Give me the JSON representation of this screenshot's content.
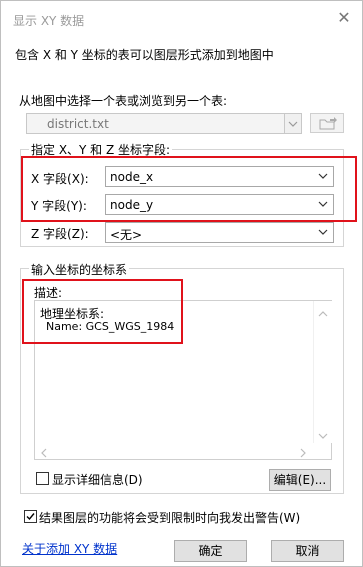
{
  "window": {
    "title": "显示 XY 数据",
    "close_glyph": "✕"
  },
  "intro_text": "包含 X 和 Y 坐标的表可以图层形式添加到地图中",
  "table_section": {
    "label": "从地图中选择一个表或浏览到另一个表:",
    "selected_table": "district.txt"
  },
  "fields_group": {
    "title": "指定 X、Y 和 Z 坐标字段:",
    "x": {
      "label": "X 字段(X):",
      "value": "node_x"
    },
    "y": {
      "label": "Y 字段(Y):",
      "value": "node_y"
    },
    "z": {
      "label": "Z 字段(Z):",
      "value": "<无>"
    }
  },
  "crs_group": {
    "title": "输入坐标的坐标系",
    "description_label": "描述:",
    "description_lines": [
      "地理坐标系:",
      "Name: GCS_WGS_1984"
    ],
    "show_details_label": "显示详细信息(D)",
    "show_details_checked": false,
    "edit_button": "编辑(E)..."
  },
  "warning_checkbox": {
    "label": "结果图层的功能将会受到限制时向我发出警告(W)",
    "checked": true
  },
  "footer": {
    "about_link": "关于添加 XY 数据",
    "ok_button": "确定",
    "cancel_button": "取消"
  },
  "colors": {
    "highlight": "#e0121b",
    "link": "#0033cc",
    "title_text": "#9a9a9a"
  }
}
